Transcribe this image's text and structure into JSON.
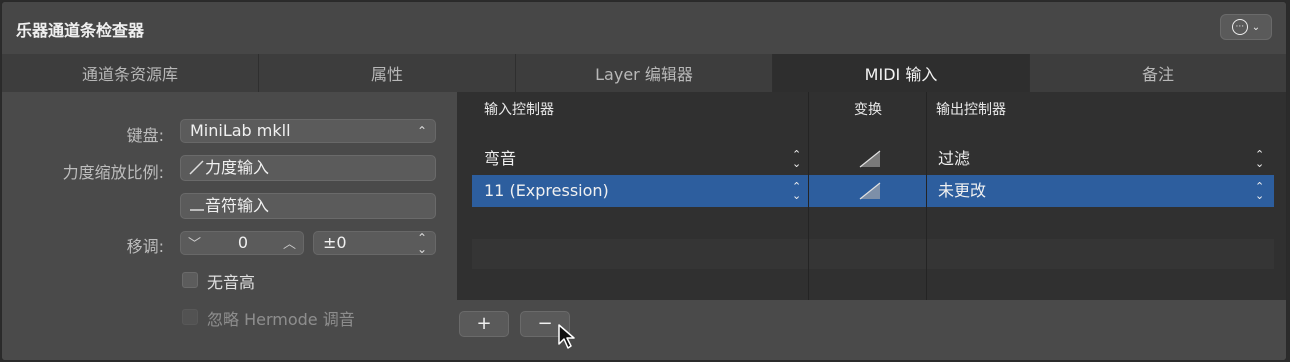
{
  "window": {
    "title": "乐器通道条检查器"
  },
  "tabs": [
    {
      "label": "通道条资源库",
      "active": false
    },
    {
      "label": "属性",
      "active": false
    },
    {
      "label": "Layer 编辑器",
      "active": false
    },
    {
      "label": "MIDI 输入",
      "active": true
    },
    {
      "label": "备注",
      "active": false
    }
  ],
  "left": {
    "keyboard_label": "键盘:",
    "keyboard_value": "MiniLab mkll",
    "velocity_label": "力度缩放比例:",
    "velocity_in": "力度输入",
    "note_in": "音符输入",
    "transpose_label": "移调:",
    "transpose_value": "0",
    "transpose_offset": "±0",
    "no_pitch_label": "无音高",
    "ignore_hermode_label": "忽略 Hermode 调音"
  },
  "table": {
    "headers": {
      "input": "输入控制器",
      "transform": "变换",
      "output": "输出控制器"
    },
    "rows": [
      {
        "input": "弯音",
        "output": "过滤",
        "selected": false
      },
      {
        "input": "11 (Expression)",
        "output": "未更改",
        "selected": true
      }
    ]
  },
  "buttons": {
    "add": "+",
    "remove": "−"
  },
  "colors": {
    "selection": "#2d5e9e",
    "panel": "#4a4a4a",
    "table_bg": "#303030"
  }
}
